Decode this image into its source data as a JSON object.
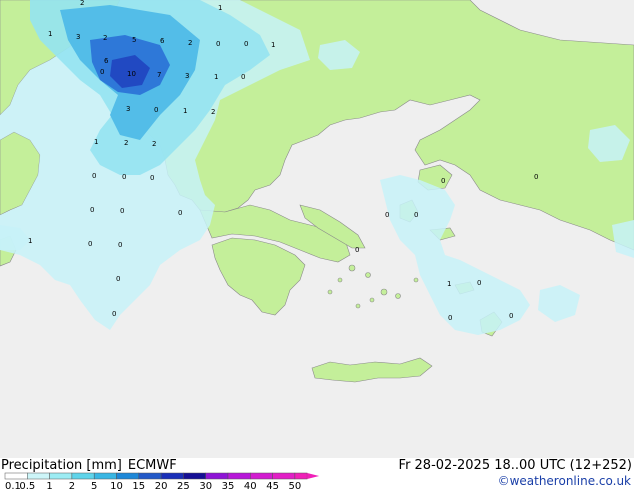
{
  "title": {
    "label": "Precipitation [mm]",
    "model": "ECMWF",
    "datetime": "Fr 28-02-2025 18..00 UTC (12+252)",
    "credit": "©weatheronline.co.uk"
  },
  "legend": {
    "ticks": [
      "0.1",
      "0.5",
      "1",
      "2",
      "5",
      "10",
      "15",
      "20",
      "25",
      "30",
      "35",
      "40",
      "45",
      "50"
    ],
    "colors": [
      "#ffffff",
      "#cdf5f8",
      "#9cecf3",
      "#5fd4ea",
      "#39b6e3",
      "#1e88d8",
      "#2359c8",
      "#1a2fb8",
      "#150f95",
      "#8e14d6",
      "#b718d9",
      "#d21cd0",
      "#e21fc6",
      "#f020b8"
    ]
  },
  "map": {
    "sea_color": "#efefef",
    "land_color": "#c4ef9a",
    "precip_light": "#c7f2f8",
    "precip_mid": "#95e3f1",
    "precip_strong": "#53bde8",
    "precip_heavy": "#2e78d8",
    "precip_core": "#2149c2",
    "values": [
      {
        "t": "1",
        "k": "v01"
      },
      {
        "t": "2",
        "k": "v02"
      },
      {
        "t": "1",
        "k": "v03"
      },
      {
        "t": "3",
        "k": "v04"
      },
      {
        "t": "2",
        "k": "v05"
      },
      {
        "t": "5",
        "k": "v06"
      },
      {
        "t": "6",
        "k": "v07"
      },
      {
        "t": "2",
        "k": "v08"
      },
      {
        "t": "0",
        "k": "v09"
      },
      {
        "t": "0",
        "k": "v10"
      },
      {
        "t": "1",
        "k": "v11"
      },
      {
        "t": "6",
        "k": "v12"
      },
      {
        "t": "10",
        "k": "v13"
      },
      {
        "t": "7",
        "k": "v14"
      },
      {
        "t": "3",
        "k": "v15"
      },
      {
        "t": "1",
        "k": "v16"
      },
      {
        "t": "0",
        "k": "v17"
      },
      {
        "t": "3",
        "k": "v18"
      },
      {
        "t": "0",
        "k": "v19"
      },
      {
        "t": "1",
        "k": "v20"
      },
      {
        "t": "2",
        "k": "v21"
      },
      {
        "t": "1",
        "k": "v22"
      },
      {
        "t": "2",
        "k": "v23"
      },
      {
        "t": "2",
        "k": "v24"
      },
      {
        "t": "0",
        "k": "v25"
      },
      {
        "t": "0",
        "k": "v26"
      },
      {
        "t": "0",
        "k": "v27"
      },
      {
        "t": "0",
        "k": "v28"
      },
      {
        "t": "0",
        "k": "v29"
      },
      {
        "t": "0",
        "k": "v30"
      },
      {
        "t": "1",
        "k": "v31"
      },
      {
        "t": "0",
        "k": "v32"
      },
      {
        "t": "0",
        "k": "v33"
      },
      {
        "t": "0",
        "k": "v34"
      },
      {
        "t": "0",
        "k": "v35"
      },
      {
        "t": "0",
        "k": "v36"
      },
      {
        "t": "0",
        "k": "v37"
      },
      {
        "t": "0",
        "k": "v38"
      },
      {
        "t": "0",
        "k": "v39"
      },
      {
        "t": "0",
        "k": "v40"
      },
      {
        "t": "1",
        "k": "v41"
      },
      {
        "t": "0",
        "k": "v42"
      },
      {
        "t": "0",
        "k": "v43"
      },
      {
        "t": "0",
        "k": "v44"
      },
      {
        "t": "0",
        "k": "v45"
      },
      {
        "t": "0",
        "k": "v46"
      },
      {
        "t": "0",
        "k": "v47"
      }
    ]
  }
}
